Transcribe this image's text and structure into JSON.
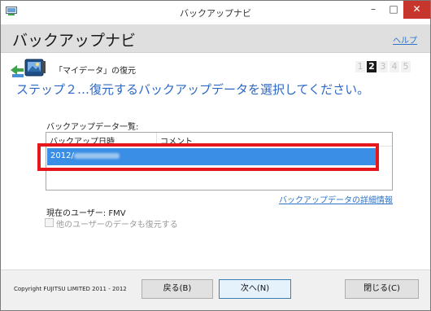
{
  "window": {
    "title": "バックアップナビ",
    "controls": {
      "minimize": "–",
      "maximize": "□",
      "close": "✕"
    },
    "icon": "backup-app-icon"
  },
  "header": {
    "app_title": "バックアップナビ",
    "help_link": "ヘルプ"
  },
  "step": {
    "section_label": "「マイデータ」の復元",
    "icon": "photo-restore-icon",
    "indicator": [
      "1",
      "2",
      "3",
      "4",
      "5"
    ],
    "active_step": "2",
    "title": "ステップ２…復元するバックアップデータを選択してください。"
  },
  "backup_list": {
    "caption": "バックアップデータ一覧:",
    "columns": [
      "バックアップ日時",
      "コメント"
    ],
    "rows": [
      {
        "date_prefix": "2012/",
        "comment": ""
      }
    ]
  },
  "details_link": "バックアップデータの詳細情報",
  "current_user": "現在のユーザー: FMV",
  "restore_others_checkbox": {
    "label": "他のユーザーのデータも復元する",
    "checked": false,
    "enabled": false
  },
  "footer": {
    "copyright": "Copyright FUJITSU LIMITED 2011 - 2012",
    "back_button": "戻る(B)",
    "next_button": "次へ(N)",
    "close_button": "閉じる(C)"
  },
  "colors": {
    "accent_blue": "#2c68c4",
    "selection": "#3a8ee6",
    "highlight_frame": "#e5161c",
    "close_button": "#c7362c"
  }
}
